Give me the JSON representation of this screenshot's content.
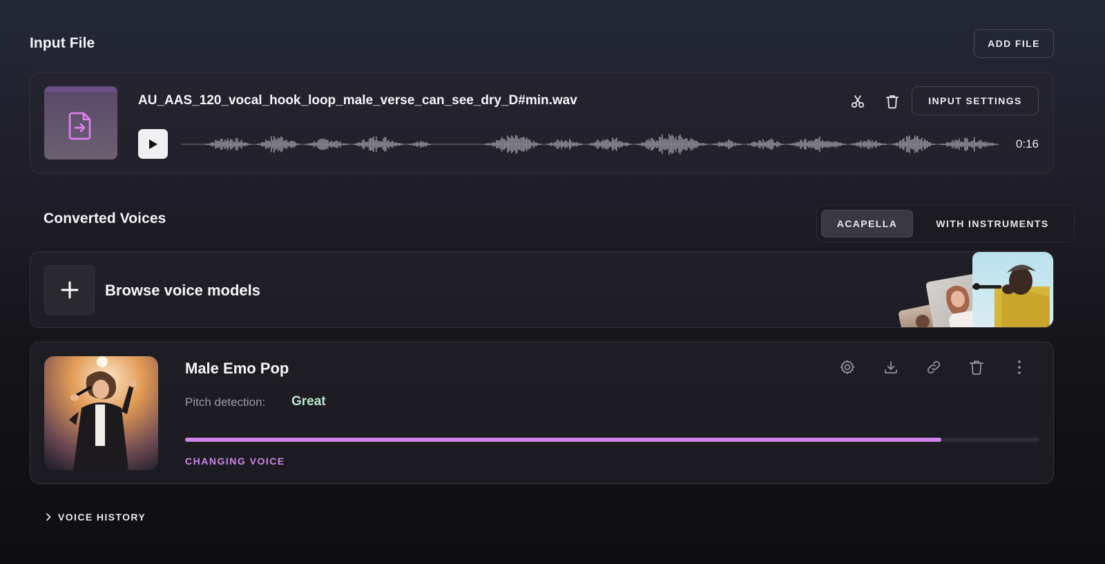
{
  "input_section": {
    "title": "Input File",
    "add_file_label": "ADD FILE"
  },
  "input_file": {
    "file_name": "AU_AAS_120_vocal_hook_loop_male_verse_can_see_dry_D#min.wav",
    "duration": "0:16",
    "settings_label": "INPUT SETTINGS",
    "icons": [
      "file-import-icon",
      "play-icon",
      "scissors-icon",
      "trash-icon"
    ]
  },
  "converted_section": {
    "title": "Converted Voices",
    "tabs": [
      {
        "label": "ACAPELLA",
        "active": true
      },
      {
        "label": "WITH INSTRUMENTS",
        "active": false
      }
    ]
  },
  "browse": {
    "label": "Browse voice models",
    "icon": "plus-icon"
  },
  "voice_card": {
    "name": "Male Emo Pop",
    "pitch_label": "Pitch detection:",
    "pitch_value": "Great",
    "progress": 0.885,
    "status": "CHANGING VOICE",
    "icons": [
      "gear-icon",
      "download-icon",
      "link-icon",
      "trash-icon",
      "more-vertical-icon"
    ]
  },
  "history": {
    "label": "VOICE HISTORY",
    "icon": "chevron-right-icon"
  },
  "colors": {
    "accent": "#cf86ea",
    "pitch_good": "#b9e6cf",
    "waveform": "#8c8c92"
  }
}
